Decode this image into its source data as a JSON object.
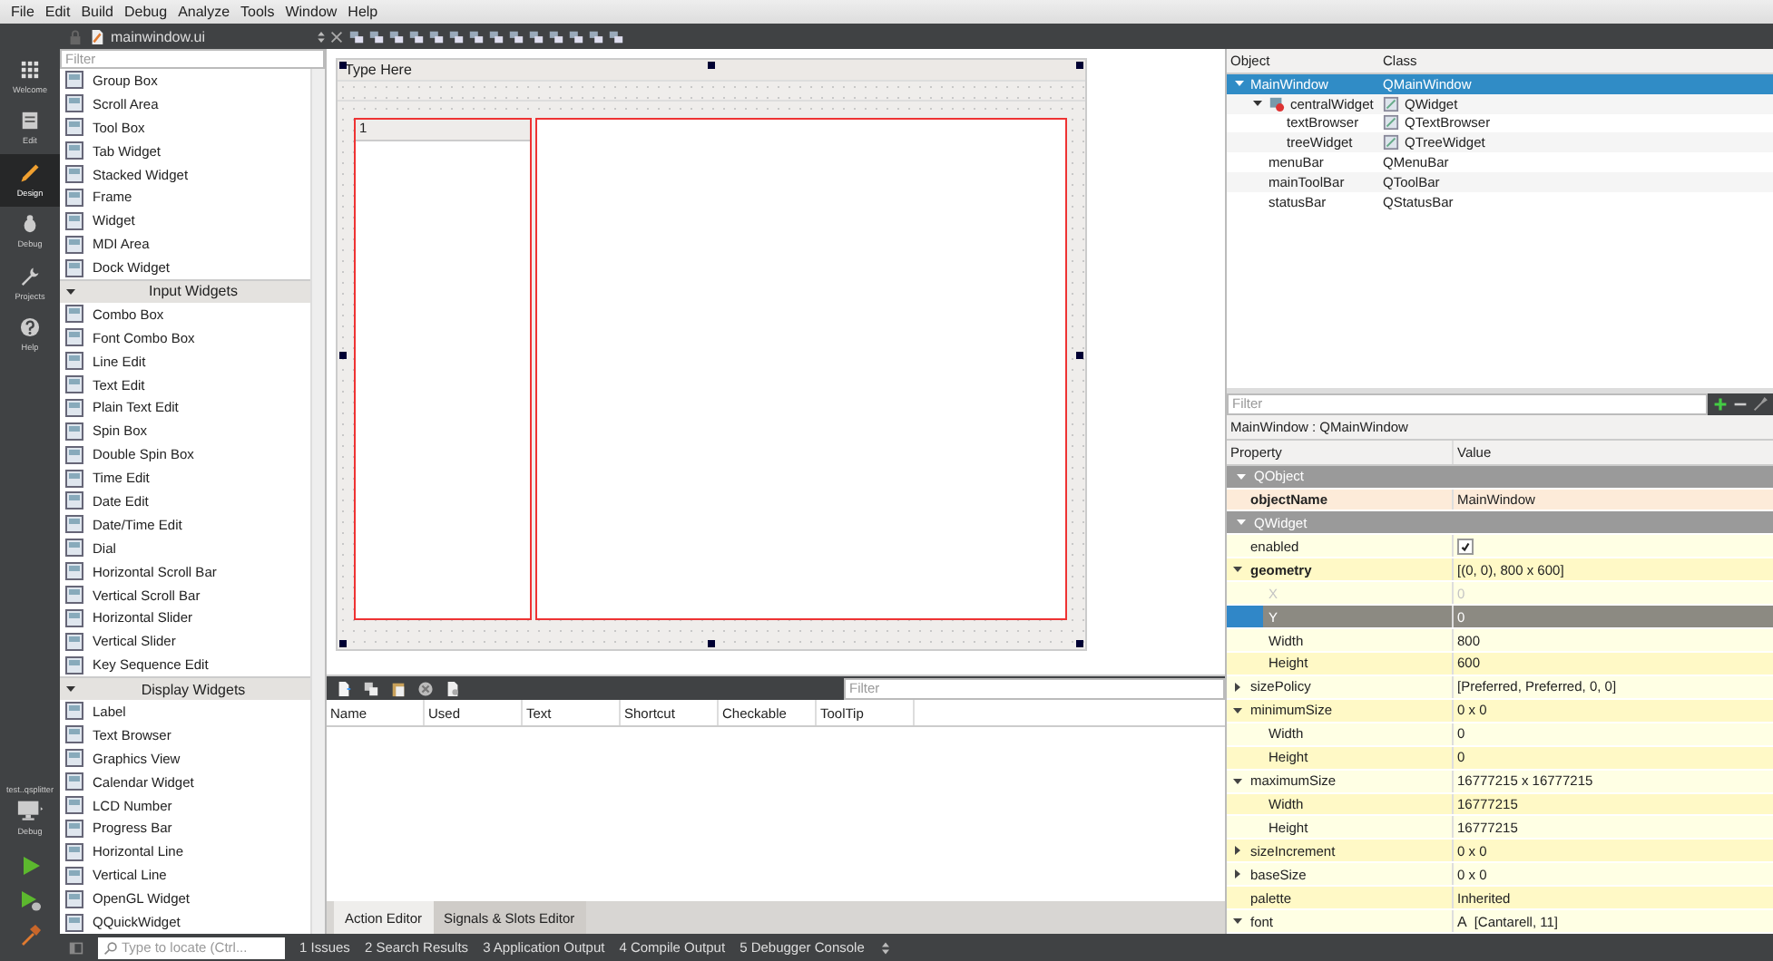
{
  "menu_bar": [
    "File",
    "Edit",
    "Build",
    "Debug",
    "Analyze",
    "Tools",
    "Window",
    "Help"
  ],
  "modes": [
    {
      "kind": "welcome",
      "label": "Welcome",
      "selected": false
    },
    {
      "kind": "edit",
      "label": "Edit",
      "selected": false
    },
    {
      "kind": "design",
      "label": "Design",
      "selected": true
    },
    {
      "kind": "debug",
      "label": "Debug",
      "selected": false
    },
    {
      "kind": "projects",
      "label": "Projects",
      "selected": false
    },
    {
      "kind": "help",
      "label": "Help",
      "selected": false
    }
  ],
  "kit": {
    "project": "test..qsplitter",
    "build": "Debug"
  },
  "editor": {
    "file": "mainwindow.ui"
  },
  "widget_box": {
    "placeholder": "Filter",
    "items": [
      {
        "kind": "item",
        "label": "Group Box"
      },
      {
        "kind": "item",
        "label": "Scroll Area"
      },
      {
        "kind": "item",
        "label": "Tool Box"
      },
      {
        "kind": "item",
        "label": "Tab Widget"
      },
      {
        "kind": "item",
        "label": "Stacked Widget"
      },
      {
        "kind": "item",
        "label": "Frame"
      },
      {
        "kind": "item",
        "label": "Widget"
      },
      {
        "kind": "item",
        "label": "MDI Area"
      },
      {
        "kind": "item",
        "label": "Dock Widget"
      },
      {
        "kind": "category",
        "label": "Input Widgets",
        "expanded": true
      },
      {
        "kind": "item",
        "label": "Combo Box"
      },
      {
        "kind": "item",
        "label": "Font Combo Box"
      },
      {
        "kind": "item",
        "label": "Line Edit"
      },
      {
        "kind": "item",
        "label": "Text Edit"
      },
      {
        "kind": "item",
        "label": "Plain Text Edit"
      },
      {
        "kind": "item",
        "label": "Spin Box"
      },
      {
        "kind": "item",
        "label": "Double Spin Box"
      },
      {
        "kind": "item",
        "label": "Time Edit"
      },
      {
        "kind": "item",
        "label": "Date Edit"
      },
      {
        "kind": "item",
        "label": "Date/Time Edit"
      },
      {
        "kind": "item",
        "label": "Dial"
      },
      {
        "kind": "item",
        "label": "Horizontal Scroll Bar"
      },
      {
        "kind": "item",
        "label": "Vertical Scroll Bar"
      },
      {
        "kind": "item",
        "label": "Horizontal Slider"
      },
      {
        "kind": "item",
        "label": "Vertical Slider"
      },
      {
        "kind": "item",
        "label": "Key Sequence Edit"
      },
      {
        "kind": "category",
        "label": "Display Widgets",
        "expanded": true
      },
      {
        "kind": "item",
        "label": "Label"
      },
      {
        "kind": "item",
        "label": "Text Browser"
      },
      {
        "kind": "item",
        "label": "Graphics View"
      },
      {
        "kind": "item",
        "label": "Calendar Widget"
      },
      {
        "kind": "item",
        "label": "LCD Number"
      },
      {
        "kind": "item",
        "label": "Progress Bar"
      },
      {
        "kind": "item",
        "label": "Horizontal Line"
      },
      {
        "kind": "item",
        "label": "Vertical Line"
      },
      {
        "kind": "item",
        "label": "OpenGL Widget"
      },
      {
        "kind": "item",
        "label": "QQuickWidget"
      }
    ]
  },
  "form": {
    "menu_placeholder": "Type Here",
    "tree_header": "1"
  },
  "action_editor": {
    "placeholder": "Filter",
    "columns": [
      "Name",
      "Used",
      "Text",
      "Shortcut",
      "Checkable",
      "ToolTip"
    ],
    "tabs": [
      {
        "label": "Action Editor",
        "selected": true
      },
      {
        "label": "Signals & Slots Editor",
        "selected": false
      }
    ]
  },
  "object_inspector": {
    "columns": [
      "Object",
      "Class"
    ],
    "rows": [
      {
        "object": "MainWindow",
        "class": "QMainWindow",
        "selected": true,
        "expanded": true,
        "object_icon": false,
        "class_icon": false,
        "children": [
          {
            "object": "centralWidget",
            "class": "QWidget",
            "selected": false,
            "expanded": true,
            "object_icon": true,
            "class_icon": true,
            "children": [
              {
                "object": "textBrowser",
                "class": "QTextBrowser",
                "selected": false,
                "object_icon": false,
                "class_icon": true
              },
              {
                "object": "treeWidget",
                "class": "QTreeWidget",
                "selected": false,
                "object_icon": false,
                "class_icon": true
              }
            ]
          },
          {
            "object": "menuBar",
            "class": "QMenuBar",
            "selected": false,
            "object_icon": false,
            "class_icon": false
          },
          {
            "object": "mainToolBar",
            "class": "QToolBar",
            "selected": false,
            "object_icon": false,
            "class_icon": false
          },
          {
            "object": "statusBar",
            "class": "QStatusBar",
            "selected": false,
            "object_icon": false,
            "class_icon": false
          }
        ]
      }
    ]
  },
  "property_editor": {
    "placeholder": "Filter",
    "title": "MainWindow : QMainWindow",
    "columns": [
      "Property",
      "Value"
    ],
    "groups": [
      {
        "name": "QObject",
        "expanded": true,
        "children": [
          {
            "name": "objectName",
            "value": "MainWindow",
            "kind": "text",
            "bold": true,
            "selected": false,
            "disabled": false
          }
        ]
      },
      {
        "name": "QWidget",
        "expanded": true,
        "children": [
          {
            "name": "enabled",
            "kind": "check",
            "checked": true,
            "bold": false,
            "selected": false,
            "disabled": false
          },
          {
            "name": "geometry",
            "value": "[(0, 0), 800 x 600]",
            "kind": "text",
            "bold": true,
            "selected": false,
            "disabled": false,
            "expanded": true,
            "children": [
              {
                "name": "X",
                "value": "0",
                "kind": "text",
                "bold": false,
                "selected": false,
                "disabled": true
              },
              {
                "name": "Y",
                "value": "0",
                "kind": "text",
                "bold": false,
                "selected": true,
                "disabled": false
              },
              {
                "name": "Width",
                "value": "800",
                "kind": "text",
                "bold": false,
                "selected": false,
                "disabled": false
              },
              {
                "name": "Height",
                "value": "600",
                "kind": "text",
                "bold": false,
                "selected": false,
                "disabled": false
              }
            ]
          },
          {
            "name": "sizePolicy",
            "value": "[Preferred, Preferred, 0, 0]",
            "kind": "text",
            "bold": false,
            "selected": false,
            "disabled": false,
            "expanded": false
          },
          {
            "name": "minimumSize",
            "value": "0 x 0",
            "kind": "text",
            "bold": false,
            "selected": false,
            "disabled": false,
            "expanded": true,
            "children": [
              {
                "name": "Width",
                "value": "0",
                "kind": "text",
                "bold": false,
                "selected": false,
                "disabled": false
              },
              {
                "name": "Height",
                "value": "0",
                "kind": "text",
                "bold": false,
                "selected": false,
                "disabled": false
              }
            ]
          },
          {
            "name": "maximumSize",
            "value": "16777215 x 16777215",
            "kind": "text",
            "bold": false,
            "selected": false,
            "disabled": false,
            "expanded": true,
            "children": [
              {
                "name": "Width",
                "value": "16777215",
                "kind": "text",
                "bold": false,
                "selected": false,
                "disabled": false
              },
              {
                "name": "Height",
                "value": "16777215",
                "kind": "text",
                "bold": false,
                "selected": false,
                "disabled": false
              }
            ]
          },
          {
            "name": "sizeIncrement",
            "value": "0 x 0",
            "kind": "text",
            "bold": false,
            "selected": false,
            "disabled": false,
            "expanded": false
          },
          {
            "name": "baseSize",
            "value": "0 x 0",
            "kind": "text",
            "bold": false,
            "selected": false,
            "disabled": false,
            "expanded": false
          },
          {
            "name": "palette",
            "value": "Inherited",
            "kind": "text",
            "bold": false,
            "selected": false,
            "disabled": false
          },
          {
            "name": "font",
            "glyph": "A",
            "value": "[Cantarell, 11]",
            "kind": "font",
            "bold": false,
            "selected": false,
            "disabled": false,
            "expanded": true
          }
        ]
      }
    ]
  },
  "status_bar": {
    "placeholder": "Type to locate (Ctrl...",
    "panes": [
      "1 Issues",
      "2 Search Results",
      "3 Application Output",
      "4 Compile Output",
      "5 Debugger Console"
    ]
  }
}
